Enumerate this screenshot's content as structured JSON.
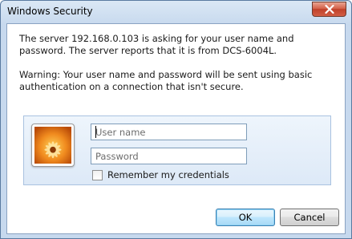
{
  "window": {
    "title": "Windows Security",
    "close_icon": "close-icon"
  },
  "message": {
    "line1": "The server 192.168.0.103 is asking for your user name and password. The server reports that it is from DCS-6004L.",
    "warning": "Warning: Your user name and password will be sent using basic authentication on a connection that isn't secure."
  },
  "credentials": {
    "avatar_icon": "user-tile-flower-icon",
    "username_placeholder": "User name",
    "username_value": "",
    "password_placeholder": "Password",
    "password_value": "",
    "remember_label": "Remember my credentials",
    "remember_checked": false
  },
  "buttons": {
    "ok_label": "OK",
    "cancel_label": "Cancel"
  },
  "colors": {
    "close_button": "#c0412a",
    "panel_background": "#dde9f7",
    "default_button_border": "#3c7fb1"
  }
}
